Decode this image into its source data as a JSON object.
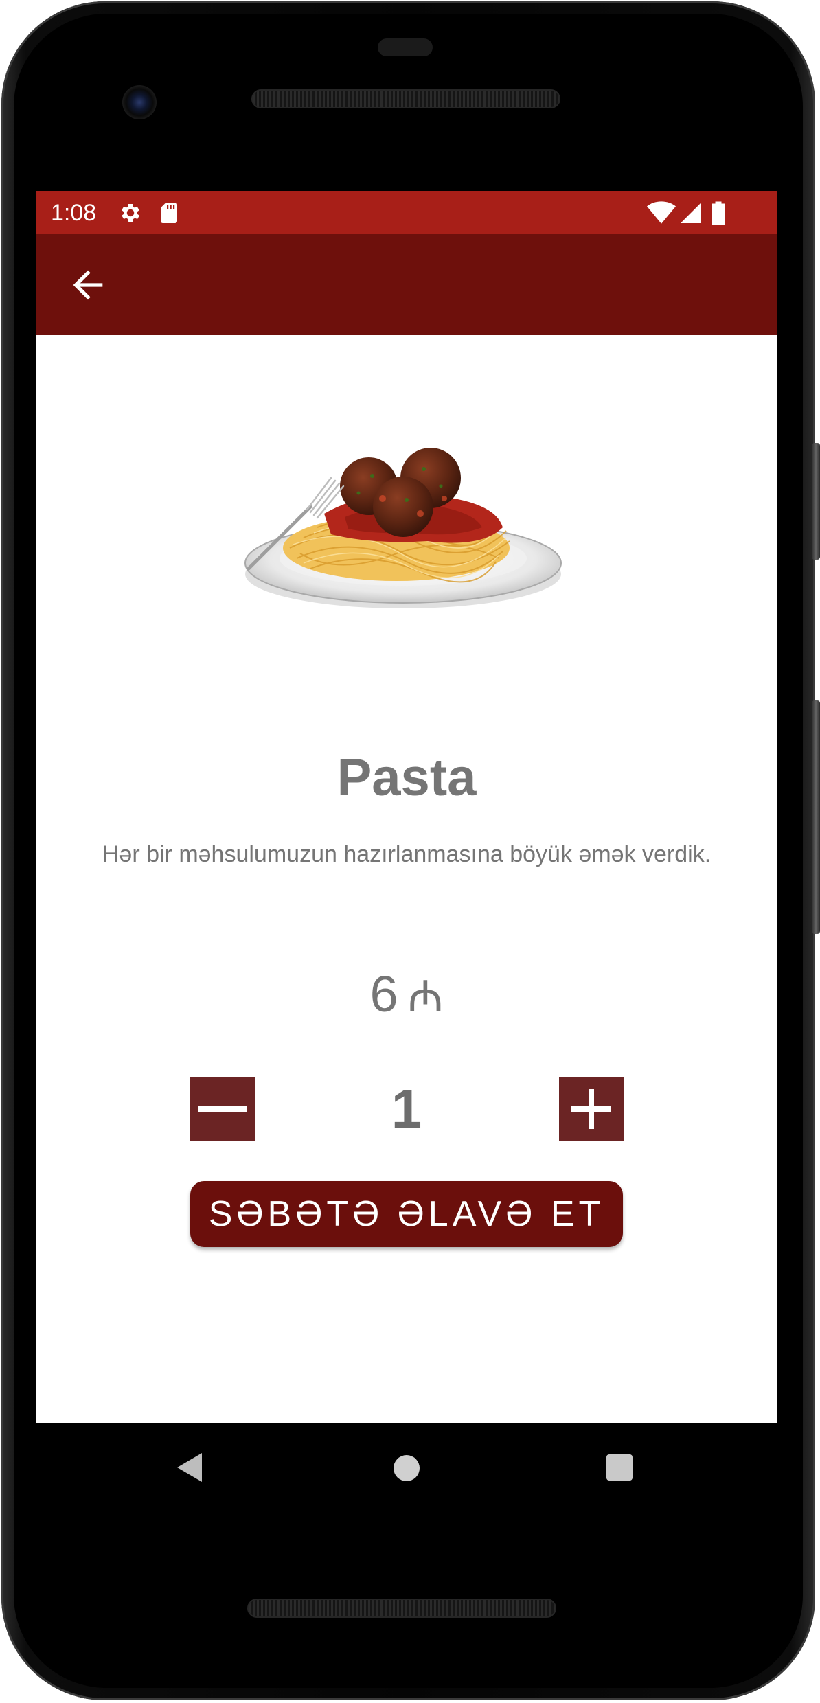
{
  "colors": {
    "status_bar": "#A81F18",
    "app_bar": "#6E100C",
    "accent_dark": "#6B0F0C",
    "qty_button": "#6B2424",
    "text_gray": "#757575"
  },
  "status_bar": {
    "time": "1:08",
    "icons": [
      "gear-icon",
      "sd-card-icon",
      "wifi-icon",
      "signal-icon",
      "battery-icon"
    ]
  },
  "app_bar": {
    "back_icon": "arrow-left-icon"
  },
  "product": {
    "image": "spaghetti-meatballs-plate",
    "title": "Pasta",
    "description": "Hər bir məhsulumuzun hazırlanmasına böyük əmək verdik.",
    "price_value": "6",
    "price_currency": "₼",
    "quantity": "1"
  },
  "actions": {
    "decrease_icon": "minus-icon",
    "increase_icon": "plus-icon",
    "add_to_cart_label": "SƏBƏTƏ ƏLAVƏ ET"
  },
  "navigation": {
    "back_icon": "triangle-back-icon",
    "home_icon": "circle-home-icon",
    "recents_icon": "square-recents-icon"
  }
}
